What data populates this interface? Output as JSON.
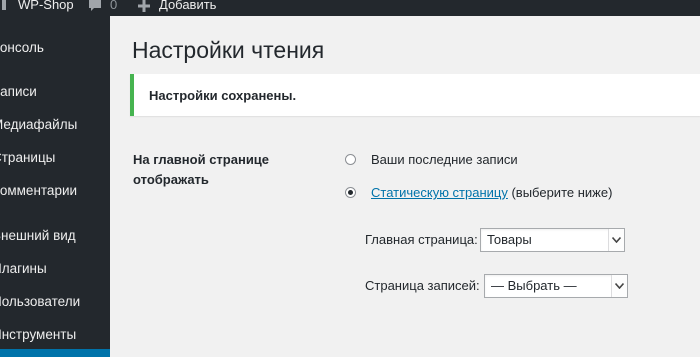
{
  "admin_bar": {
    "site_title": "WP-Shop",
    "comments_count": "0",
    "new_label": "Добавить"
  },
  "sidebar": {
    "items": [
      {
        "label": "Консоль"
      },
      {
        "label": "Записи"
      },
      {
        "label": "Медиафайлы"
      },
      {
        "label": "Страницы"
      },
      {
        "label": "Комментарии"
      },
      {
        "label": "Внешний вид"
      },
      {
        "label": "Плагины"
      },
      {
        "label": "Пользователи"
      },
      {
        "label": "Инструменты"
      }
    ]
  },
  "page": {
    "title": "Настройки чтения",
    "notice": "Настройки сохранены.",
    "front_page_label": "На главной странице отображать",
    "options": {
      "latest_posts": "Ваши последние записи",
      "static_page_link": "Статическую страницу",
      "static_page_hint": " (выберите ниже)"
    },
    "selected_option": "static_page",
    "homepage_label": "Главная страница:",
    "homepage_value": "Товары",
    "posts_page_label": "Страница записей:",
    "posts_page_value": "— Выбрать —"
  },
  "colors": {
    "sidebar_bg": "#23282d",
    "main_bg": "#f1f1f1",
    "link": "#0073aa",
    "notice_success": "#46b450"
  }
}
